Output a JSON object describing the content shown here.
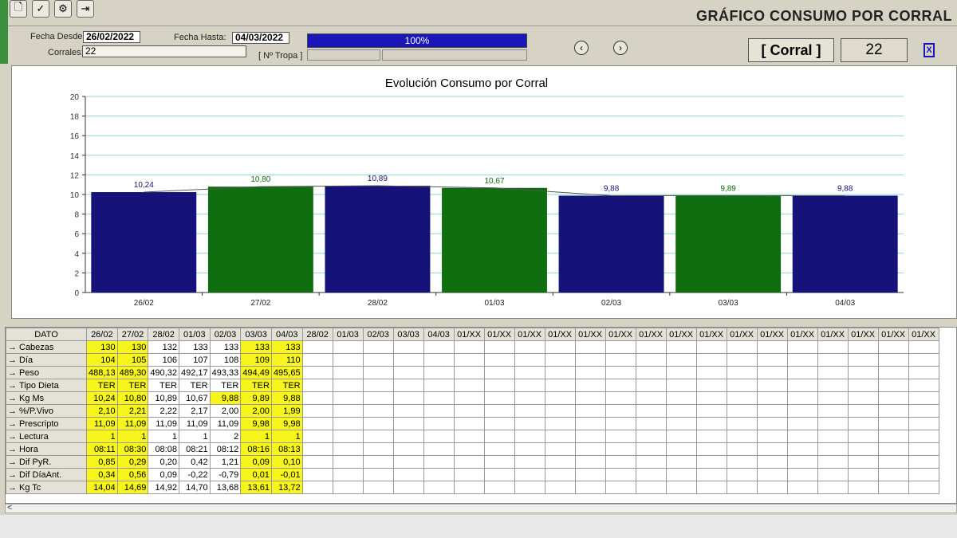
{
  "window": {
    "title": "GRÁFICO CONSUMO POR CORRAL"
  },
  "toolbar": {
    "buttons": [
      {
        "icon": "new-document-icon",
        "glyph": "🗋"
      },
      {
        "icon": "check-icon",
        "glyph": "✓"
      },
      {
        "icon": "gear-icon",
        "glyph": "⚙"
      },
      {
        "icon": "exit-door-icon",
        "glyph": "⇥"
      }
    ]
  },
  "filters": {
    "fecha_desde_label": "Fecha Desde:",
    "fecha_desde_value": "26/02/2022",
    "fecha_hasta_label": "Fecha Hasta:",
    "fecha_hasta_value": "04/03/2022",
    "corrales_label": "Corrales:",
    "corrales_value": "22",
    "tropa_label": "[ Nº Tropa ]",
    "progress_percent": 100,
    "progress_text": "100%"
  },
  "nav": {
    "prev_glyph": "‹",
    "next_glyph": "›"
  },
  "corral": {
    "button_label": "[ Corral ]",
    "number": "22",
    "exit_glyph": "X"
  },
  "colors": {
    "blue": "#15137a",
    "green": "#0f6e0f",
    "accent": "#1a16b8",
    "highlight": "#f7f51c"
  },
  "chart_data": {
    "type": "bar",
    "title": "Evolución Consumo por Corral",
    "categories": [
      "26/02",
      "27/02",
      "28/02",
      "01/03",
      "02/03",
      "03/03",
      "04/03"
    ],
    "values": [
      10.24,
      10.8,
      10.89,
      10.67,
      9.88,
      9.89,
      9.88
    ],
    "value_labels": [
      "10,24",
      "10,80",
      "10,89",
      "10,67",
      "9,88",
      "9,89",
      "9,88"
    ],
    "bar_colors": [
      "#15137a",
      "#0f6e0f",
      "#15137a",
      "#0f6e0f",
      "#15137a",
      "#0f6e0f",
      "#15137a"
    ],
    "ylim": [
      0,
      20
    ],
    "yticks": [
      0,
      2,
      4,
      6,
      8,
      10,
      12,
      14,
      16,
      18,
      20
    ],
    "grid": true
  },
  "grid": {
    "header_first": "DATO",
    "columns": [
      "26/02",
      "27/02",
      "28/02",
      "01/03",
      "02/03",
      "03/03",
      "04/03",
      "28/02",
      "01/03",
      "02/03",
      "03/03",
      "04/03",
      "01/XX",
      "01/XX",
      "01/XX",
      "01/XX",
      "01/XX",
      "01/XX",
      "01/XX",
      "01/XX",
      "01/XX",
      "01/XX",
      "01/XX",
      "01/XX",
      "01/XX",
      "01/XX",
      "01/XX",
      "01/XX"
    ],
    "arrow_glyph": "→",
    "rows": [
      {
        "label": "Cabezas",
        "values": [
          "130",
          "130",
          "132",
          "133",
          "133",
          "133",
          "133"
        ]
      },
      {
        "label": "Día",
        "values": [
          "104",
          "105",
          "106",
          "107",
          "108",
          "109",
          "110"
        ]
      },
      {
        "label": "Peso",
        "values": [
          "488,13",
          "489,30",
          "490,32",
          "492,17",
          "493,33",
          "494,49",
          "495,65"
        ]
      },
      {
        "label": "Tipo Dieta",
        "values": [
          "TER",
          "TER",
          "TER",
          "TER",
          "TER",
          "TER",
          "TER"
        ]
      },
      {
        "label": "Kg Ms",
        "values": [
          "10,24",
          "10,80",
          "10,89",
          "10,67",
          "9,88",
          "9,89",
          "9,88"
        ]
      },
      {
        "label": "%/P.Vivo",
        "values": [
          "2,10",
          "2,21",
          "2,22",
          "2,17",
          "2,00",
          "2,00",
          "1,99"
        ]
      },
      {
        "label": "Prescripto",
        "values": [
          "11,09",
          "11,09",
          "11,09",
          "11,09",
          "11,09",
          "9,98",
          "9,98"
        ]
      },
      {
        "label": "Lectura",
        "values": [
          "1",
          "1",
          "1",
          "1",
          "2",
          "1",
          "1"
        ]
      },
      {
        "label": "Hora",
        "values": [
          "08:11",
          "08:30",
          "08:08",
          "08:21",
          "08:12",
          "08:16",
          "08:13"
        ]
      },
      {
        "label": "Dif PyR.",
        "values": [
          "0,85",
          "0,29",
          "0,20",
          "0,42",
          "1,21",
          "0,09",
          "0,10"
        ]
      },
      {
        "label": "Dif DíaAnt.",
        "values": [
          "0,34",
          "0,56",
          "0,09",
          "-0,22",
          "-0,79",
          "0,01",
          "-0,01"
        ]
      },
      {
        "label": "Kg Tc",
        "values": [
          "14,04",
          "14,69",
          "14,92",
          "14,70",
          "13,68",
          "13,61",
          "13,72"
        ]
      }
    ],
    "highlight_cells": [
      [
        1,
        1,
        0,
        0,
        0,
        1,
        1
      ],
      [
        1,
        1,
        0,
        0,
        0,
        1,
        1
      ],
      [
        1,
        1,
        0,
        0,
        0,
        1,
        1
      ],
      [
        1,
        1,
        0,
        0,
        0,
        1,
        1
      ],
      [
        1,
        1,
        0,
        0,
        1,
        1,
        1
      ],
      [
        1,
        1,
        0,
        0,
        0,
        1,
        1
      ],
      [
        1,
        1,
        0,
        0,
        0,
        1,
        1
      ],
      [
        1,
        1,
        0,
        0,
        0,
        1,
        1
      ],
      [
        1,
        1,
        0,
        0,
        0,
        1,
        1
      ],
      [
        1,
        1,
        0,
        0,
        0,
        1,
        1
      ],
      [
        1,
        1,
        0,
        0,
        0,
        1,
        1
      ],
      [
        1,
        1,
        0,
        0,
        0,
        1,
        1
      ]
    ]
  },
  "scroll": {
    "left_glyph": "<"
  }
}
